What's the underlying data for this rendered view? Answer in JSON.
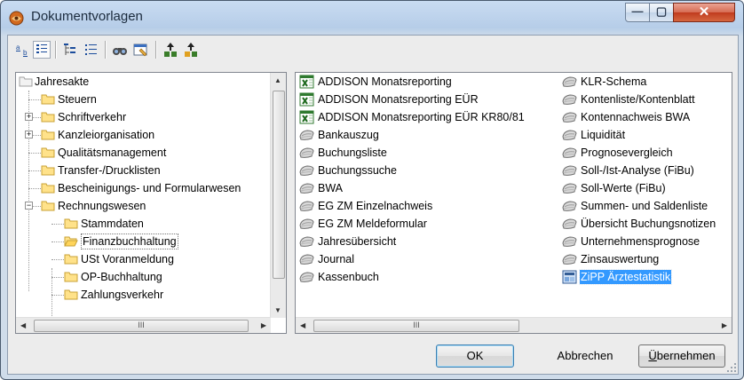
{
  "window": {
    "title": "Dokumentvorlagen",
    "controls": {
      "minimize": "—",
      "maximize": "▢",
      "close": "✕"
    }
  },
  "toolbar": {
    "buttons": [
      "large-icons-view-icon",
      "details-view-icon",
      "tree-expand-icon",
      "tree-collapse-icon",
      "find-icon",
      "properties-icon",
      "move-up-icon",
      "add-template-icon"
    ]
  },
  "tree": {
    "items": [
      {
        "label": "Jahresakte"
      },
      {
        "label": "Steuern"
      },
      {
        "label": "Schriftverkehr",
        "expander": "+"
      },
      {
        "label": "Kanzleiorganisation",
        "expander": "+"
      },
      {
        "label": "Qualitätsmanagement"
      },
      {
        "label": "Transfer-/Drucklisten"
      },
      {
        "label": "Bescheinigungs- und Formularwesen"
      },
      {
        "label": "Rechnungswesen",
        "expander": "−"
      },
      {
        "label": "Stammdaten"
      },
      {
        "label": "Finanzbuchhaltung"
      },
      {
        "label": "USt Voranmeldung"
      },
      {
        "label": "OP-Buchhaltung"
      },
      {
        "label": "Zahlungsverkehr"
      }
    ],
    "scroll_thumb_label": "III"
  },
  "templates": {
    "column1": [
      {
        "label": "ADDISON Monatsreporting",
        "icon": "excel-icon"
      },
      {
        "label": "ADDISON Monatsreporting EÜR",
        "icon": "excel-icon"
      },
      {
        "label": "ADDISON Monatsreporting EÜR KR80/81",
        "icon": "excel-icon"
      },
      {
        "label": "Bankauszug",
        "icon": "report-icon"
      },
      {
        "label": "Buchungsliste",
        "icon": "report-icon"
      },
      {
        "label": "Buchungssuche",
        "icon": "report-icon"
      },
      {
        "label": "BWA",
        "icon": "report-icon"
      },
      {
        "label": "EG ZM Einzelnachweis",
        "icon": "report-icon"
      },
      {
        "label": "EG ZM Meldeformular",
        "icon": "report-icon"
      },
      {
        "label": "Jahresübersicht",
        "icon": "report-icon"
      },
      {
        "label": "Journal",
        "icon": "report-icon"
      },
      {
        "label": "Kassenbuch",
        "icon": "report-icon"
      }
    ],
    "column2": [
      {
        "label": "KLR-Schema",
        "icon": "report-icon"
      },
      {
        "label": "Kontenliste/Kontenblatt",
        "icon": "report-icon"
      },
      {
        "label": "Kontennachweis BWA",
        "icon": "report-icon"
      },
      {
        "label": "Liquidität",
        "icon": "report-icon"
      },
      {
        "label": "Prognosevergleich",
        "icon": "report-icon"
      },
      {
        "label": "Soll-/Ist-Analyse (FiBu)",
        "icon": "report-icon"
      },
      {
        "label": "Soll-Werte (FiBu)",
        "icon": "report-icon"
      },
      {
        "label": "Summen- und Saldenliste",
        "icon": "report-icon"
      },
      {
        "label": "Übersicht Buchungsnotizen",
        "icon": "report-icon"
      },
      {
        "label": "Unternehmensprognose",
        "icon": "report-icon"
      },
      {
        "label": "Zinsauswertung",
        "icon": "report-icon"
      },
      {
        "label": "ZiPP Ärztestatistik",
        "icon": "zipp-icon",
        "selected": true
      }
    ],
    "scroll_thumb_label": "III"
  },
  "buttons": {
    "ok": "OK",
    "cancel": "Abbrechen",
    "apply": "Übernehmen"
  }
}
